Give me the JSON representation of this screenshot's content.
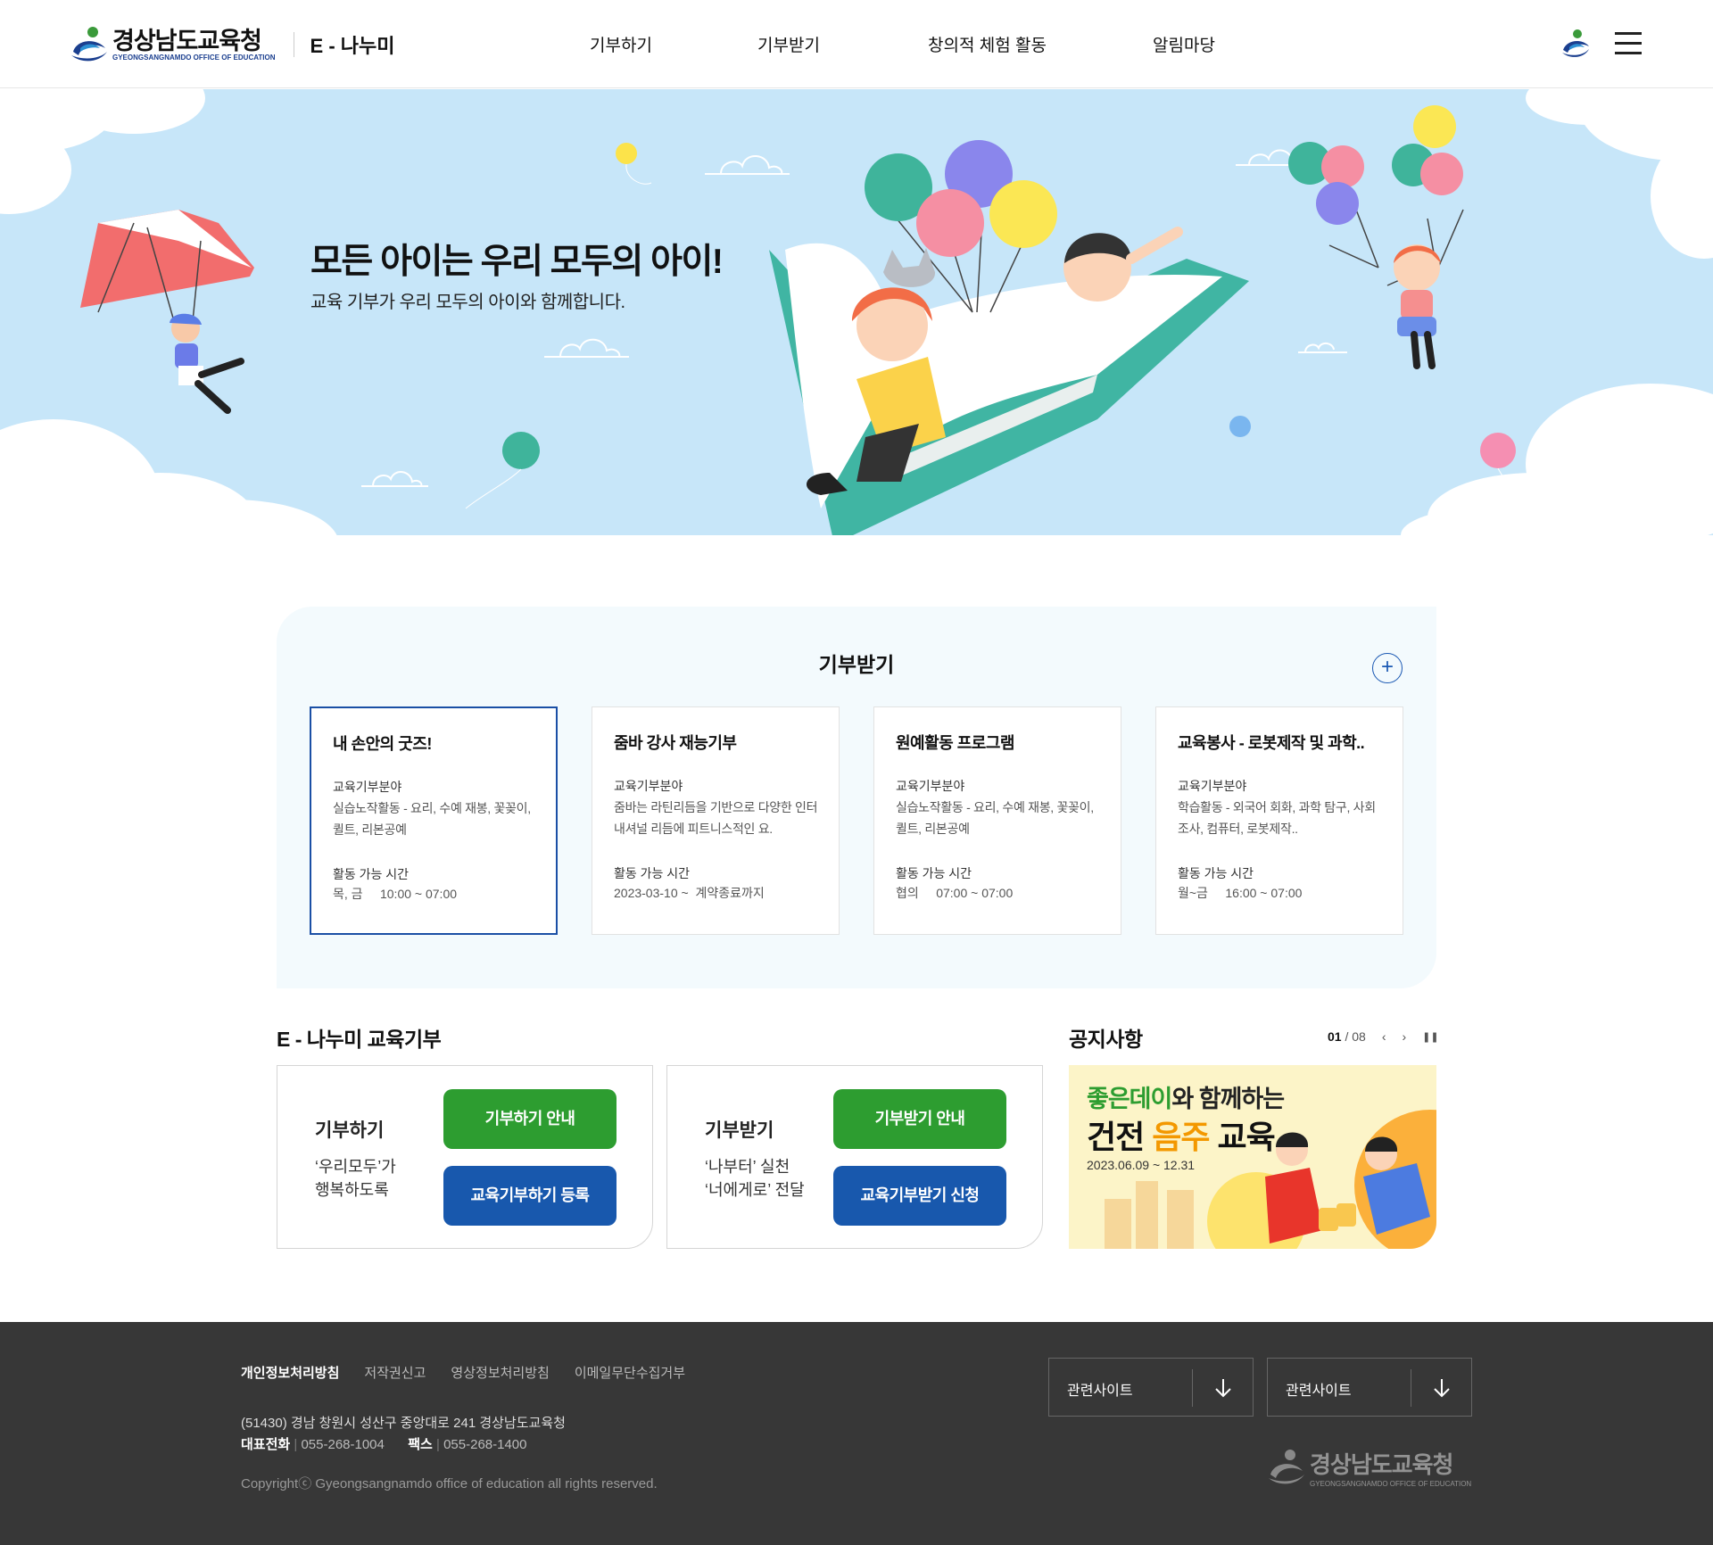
{
  "header": {
    "logo_kr": "경상남도교육청",
    "logo_en": "GYEONGSANGNAMDO OFFICE OF EDUCATION",
    "site_name": "E - 나누미",
    "nav": [
      "기부하기",
      "기부받기",
      "창의적 체험 활동",
      "알림마당"
    ],
    "icons": [
      "symbol-icon",
      "hamburger-menu-icon"
    ]
  },
  "hero": {
    "title": "모든 아이는 우리 모두의 아이!",
    "subtitle": "교육 기부가 우리 모두의 아이와 함께합니다."
  },
  "receive": {
    "title": "기부받기",
    "more_label": "+",
    "field_label": "교육기부분야",
    "time_label": "활동 가능 시간",
    "cards": [
      {
        "title": "내 손안의 굿즈!",
        "field": "실습노작활동 - 요리, 수예 재봉, 꽃꽂이, 퀼트, 리본공예",
        "time": "목, 금     10:00 ~ 07:00",
        "active": true
      },
      {
        "title": "줌바 강사 재능기부",
        "field": "줌바는 라틴리듬을 기반으로 다양한 인터내셔널 리듬에 피트니스적인 요.",
        "time": "2023-03-10 ~  계약종료까지",
        "active": false
      },
      {
        "title": "원예활동 프로그램",
        "field": "실습노작활동 - 요리, 수예 재봉, 꽃꽂이, 퀼트, 리본공예",
        "time": "협의     07:00 ~ 07:00",
        "active": false
      },
      {
        "title": "교육봉사 - 로봇제작 및 과학..",
        "field": "학습활동 - 외국어 회화, 과학 탐구, 사회 조사, 컴퓨터, 로봇제작..",
        "time": "월~금     16:00 ~ 07:00",
        "active": false
      }
    ]
  },
  "enanumi": {
    "title": "E - 나누미 교육기부",
    "boxes": [
      {
        "title": "기부하기",
        "desc": "‘우리모두’가\n행복하도록",
        "btn1": "기부하기 안내",
        "btn2": "교육기부하기 등록"
      },
      {
        "title": "기부받기",
        "desc": "‘나부터’ 실천\n‘너에게로’ 전달",
        "btn1": "기부받기 안내",
        "btn2": "교육기부받기 신청"
      }
    ]
  },
  "notice": {
    "title": "공지사항",
    "current": "01",
    "total": "/ 08",
    "banner_line1a": "좋은데이",
    "banner_line1b": "와 함께하는",
    "banner_line2a": "건전 ",
    "banner_line2b": "음주",
    "banner_line2c": " 교육",
    "banner_date": "2023.06.09 ~ 12.31"
  },
  "footer": {
    "links": [
      "개인정보처리방침",
      "저작권신고",
      "영상정보처리방침",
      "이메일무단수집거부"
    ],
    "address": "(51430) 경남 창원시 성산구 중앙대로 241 경상남도교육청",
    "tel_label": "대표전화",
    "tel": "055-268-1004",
    "fax_label": "팩스",
    "fax": "055-268-1400",
    "copyright": "Copyrightⓒ Gyeongsangnamdo office of education all rights reserved.",
    "selects": [
      "관련사이트",
      "관련사이트"
    ],
    "logo_kr": "경상남도교육청",
    "logo_en": "GYEONGSANGNAMDO OFFICE OF EDUCATION"
  },
  "colors": {
    "accent_blue": "#1858ad",
    "accent_green": "#2d9d30",
    "hero_bg": "#c7e6f9",
    "footer_bg": "#373737"
  }
}
